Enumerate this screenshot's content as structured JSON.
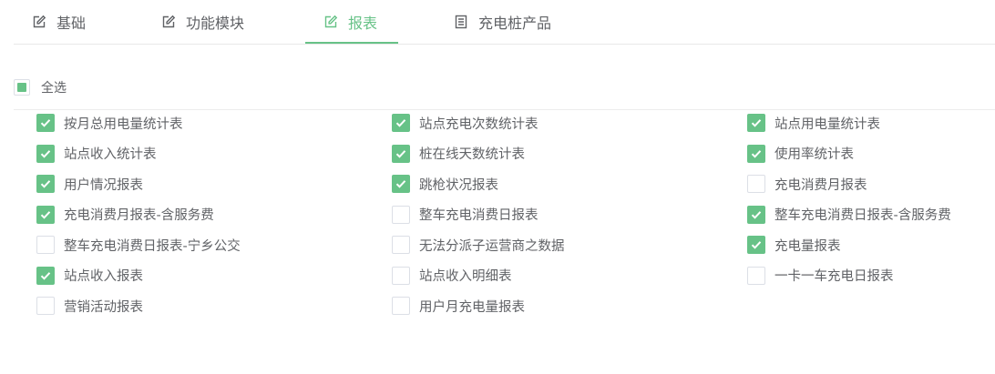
{
  "tabs": [
    {
      "label": "基础",
      "icon": "edit-icon",
      "active": false
    },
    {
      "label": "功能模块",
      "icon": "edit-icon",
      "active": false
    },
    {
      "label": "报表",
      "icon": "edit-icon",
      "active": true
    },
    {
      "label": "充电桩产品",
      "icon": "document-icon",
      "active": false
    }
  ],
  "select_all": {
    "label": "全选",
    "state": "indeterminate"
  },
  "colors": {
    "accent": "#67c287",
    "text": "#606266",
    "border": "#dcdfe6"
  },
  "reports": [
    [
      {
        "label": "按月总用电量统计表",
        "checked": true
      },
      {
        "label": "站点充电次数统计表",
        "checked": true
      },
      {
        "label": "站点用电量统计表",
        "checked": true
      }
    ],
    [
      {
        "label": "站点收入统计表",
        "checked": true
      },
      {
        "label": "桩在线天数统计表",
        "checked": true
      },
      {
        "label": "使用率统计表",
        "checked": true
      }
    ],
    [
      {
        "label": "用户情况报表",
        "checked": true
      },
      {
        "label": "跳枪状况报表",
        "checked": true
      },
      {
        "label": "充电消费月报表",
        "checked": false
      }
    ],
    [
      {
        "label": "充电消费月报表-含服务费",
        "checked": true
      },
      {
        "label": "整车充电消费日报表",
        "checked": false
      },
      {
        "label": "整车充电消费日报表-含服务费",
        "checked": true
      }
    ],
    [
      {
        "label": "整车充电消费日报表-宁乡公交",
        "checked": false
      },
      {
        "label": "无法分派子运营商之数据",
        "checked": false
      },
      {
        "label": "充电量报表",
        "checked": true
      }
    ],
    [
      {
        "label": "站点收入报表",
        "checked": true
      },
      {
        "label": "站点收入明细表",
        "checked": false
      },
      {
        "label": "一卡一车充电日报表",
        "checked": false
      }
    ],
    [
      {
        "label": "营销活动报表",
        "checked": false
      },
      {
        "label": "用户月充电量报表",
        "checked": false
      }
    ]
  ]
}
